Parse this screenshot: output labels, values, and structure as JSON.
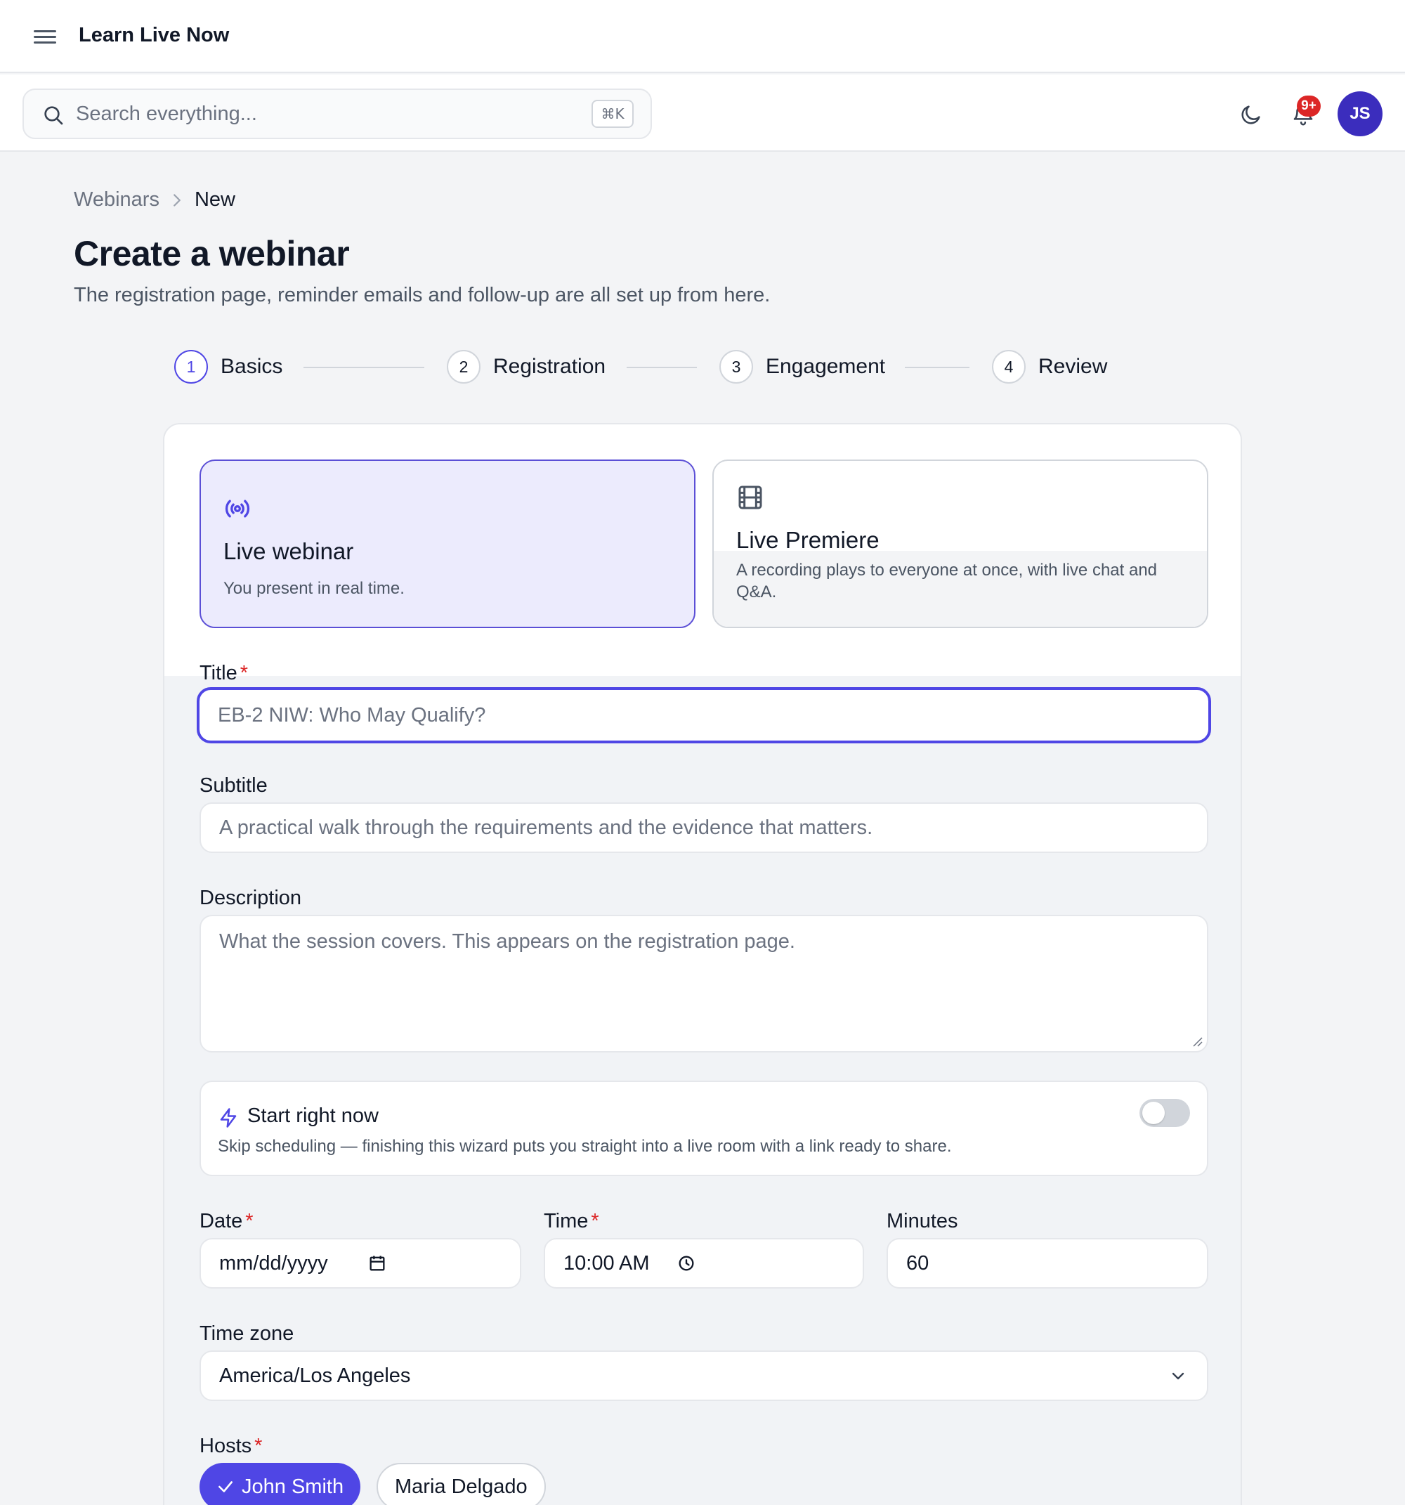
{
  "app": {
    "title": "Learn Live Now"
  },
  "search": {
    "placeholder": "Search everything...",
    "shortcut": "⌘K"
  },
  "header": {
    "notification_badge": "9+",
    "avatar_initials": "JS"
  },
  "breadcrumb": {
    "parent": "Webinars",
    "current": "New"
  },
  "page": {
    "title": "Create a webinar",
    "subtitle": "The registration page, reminder emails and follow-up are all set up from here."
  },
  "steps": [
    {
      "number": "1",
      "label": "Basics",
      "active": true
    },
    {
      "number": "2",
      "label": "Registration",
      "active": false
    },
    {
      "number": "3",
      "label": "Engagement",
      "active": false
    },
    {
      "number": "4",
      "label": "Review",
      "active": false
    }
  ],
  "webinar_types": [
    {
      "title": "Live webinar",
      "description": "You present in real time.",
      "icon": "broadcast-icon",
      "selected": true
    },
    {
      "title": "Live Premiere",
      "description": "A recording plays to everyone at once, with live chat and Q&A.",
      "icon": "film-icon",
      "selected": false
    }
  ],
  "form": {
    "title": {
      "label": "Title",
      "required_mark": "*",
      "placeholder": "EB-2 NIW: Who May Qualify?"
    },
    "subtitle": {
      "label": "Subtitle",
      "placeholder": "A practical walk through the requirements and the evidence that matters."
    },
    "description": {
      "label": "Description",
      "placeholder": "What the session covers. This appears on the registration page."
    },
    "start_now": {
      "title": "Start right now",
      "description": "Skip scheduling — finishing this wizard puts you straight into a live room with a link ready to share.",
      "enabled": false
    },
    "date": {
      "label": "Date",
      "required_mark": "*",
      "value": "mm/dd/yyyy"
    },
    "time": {
      "label": "Time",
      "required_mark": "*",
      "value": "10:00 AM"
    },
    "minutes": {
      "label": "Minutes",
      "value": "60"
    },
    "timezone": {
      "label": "Time zone",
      "value": "America/Los Angeles"
    },
    "hosts": {
      "label": "Hosts",
      "required_mark": "*",
      "options": [
        {
          "name": "John Smith",
          "selected": true
        },
        {
          "name": "Maria Delgado",
          "selected": false
        }
      ]
    }
  },
  "colors": {
    "accent": "#4f46e5",
    "avatar": "#3b2dbd",
    "badge": "#dc2626",
    "selected_card": "#ecebfd"
  }
}
